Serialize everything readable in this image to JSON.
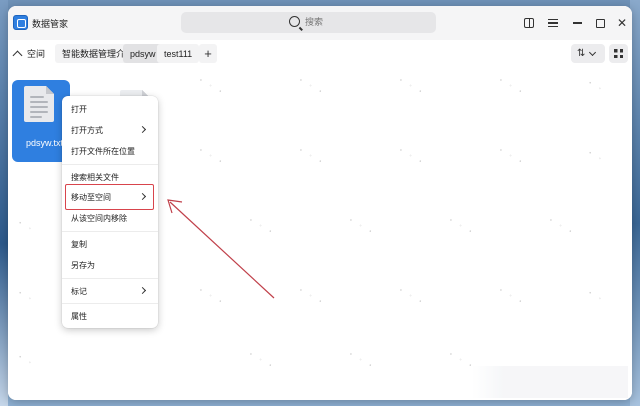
{
  "window": {
    "title": "数据管家"
  },
  "search": {
    "placeholder": "搜索"
  },
  "toolbar": {
    "spaces_label": "空间",
    "tabs": [
      {
        "label": "智能数据管理介绍",
        "active": false
      },
      {
        "label": "pdsyw",
        "active": true
      },
      {
        "label": "test111",
        "active": false
      }
    ],
    "add_tab": "+"
  },
  "files": [
    {
      "name": "pdsyw.txt",
      "selected": true,
      "icon": "document-icon"
    },
    {
      "name": "",
      "selected": false,
      "icon": "document-icon"
    }
  ],
  "context_menu": {
    "items": [
      {
        "label": "打开",
        "submenu": false
      },
      {
        "label": "打开方式",
        "submenu": true
      },
      {
        "label": "打开文件所在位置",
        "submenu": false
      },
      {
        "label": "搜索相关文件",
        "submenu": false
      },
      {
        "label": "移动至空间",
        "submenu": true,
        "highlighted": true
      },
      {
        "label": "从该空间内移除",
        "submenu": false
      },
      {
        "label": "复制",
        "submenu": false
      },
      {
        "label": "另存为",
        "submenu": false
      },
      {
        "label": "标记",
        "submenu": true
      },
      {
        "label": "属性",
        "submenu": false
      }
    ]
  },
  "colors": {
    "accent": "#2f7fe0",
    "annotation": "#d8444c"
  }
}
